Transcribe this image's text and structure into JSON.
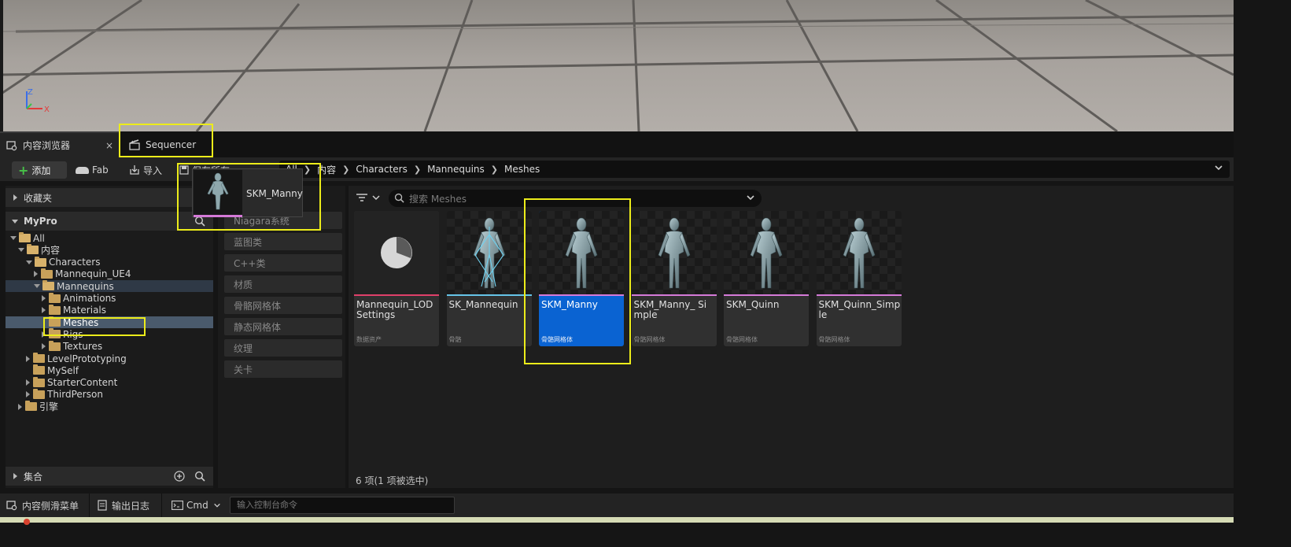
{
  "viewport": {
    "axis_z": "Z",
    "axis_x": "X"
  },
  "tabs": [
    {
      "label": "内容浏览器",
      "icon": "content-browser-icon",
      "close": "×"
    },
    {
      "label": "Sequencer",
      "icon": "clapperboard-icon"
    }
  ],
  "toolbar": {
    "add_label": "添加",
    "fab_label": "Fab",
    "import_label": "导入",
    "save_all_label": "保存所有"
  },
  "breadcrumb": [
    "All",
    "内容",
    "Characters",
    "Mannequins",
    "Meshes"
  ],
  "left_panel": {
    "favorites_label": "收藏夹",
    "project_label": "MyPro",
    "collections_label": "集合",
    "tree": [
      {
        "label": "All",
        "depth": 0,
        "expanded": true,
        "has_children": true
      },
      {
        "label": "内容",
        "depth": 1,
        "expanded": true,
        "has_children": true
      },
      {
        "label": "Characters",
        "depth": 2,
        "expanded": true,
        "has_children": true
      },
      {
        "label": "Mannequin_UE4",
        "depth": 3,
        "expanded": false,
        "has_children": true
      },
      {
        "label": "Mannequins",
        "depth": 3,
        "expanded": true,
        "has_children": true,
        "highlight": true
      },
      {
        "label": "Animations",
        "depth": 4,
        "expanded": false,
        "has_children": true
      },
      {
        "label": "Materials",
        "depth": 4,
        "expanded": false,
        "has_children": true
      },
      {
        "label": "Meshes",
        "depth": 4,
        "expanded": false,
        "has_children": false,
        "selected": true
      },
      {
        "label": "Rigs",
        "depth": 4,
        "expanded": false,
        "has_children": true
      },
      {
        "label": "Textures",
        "depth": 4,
        "expanded": false,
        "has_children": true
      },
      {
        "label": "LevelPrototyping",
        "depth": 2,
        "expanded": false,
        "has_children": true
      },
      {
        "label": "MySelf",
        "depth": 2,
        "expanded": false,
        "has_children": false
      },
      {
        "label": "StarterContent",
        "depth": 2,
        "expanded": false,
        "has_children": true
      },
      {
        "label": "ThirdPerson",
        "depth": 2,
        "expanded": false,
        "has_children": true
      },
      {
        "label": "引擎",
        "depth": 1,
        "expanded": false,
        "has_children": true
      }
    ]
  },
  "filters": [
    "Niagara系统",
    "蓝图类",
    "C++类",
    "材质",
    "骨骼网格体",
    "静态网格体",
    "纹理",
    "关卡"
  ],
  "search": {
    "placeholder": "搜索 Meshes"
  },
  "assets": [
    {
      "name": "Mannequin_LOD Settings",
      "type": "数据资产",
      "stripe": "#e0406a",
      "kind": "data",
      "selected": false
    },
    {
      "name": "SK_Mannequin",
      "type": "骨骼",
      "stripe": "#66c4e8",
      "kind": "skeleton",
      "selected": false
    },
    {
      "name": "SKM_Manny",
      "type": "骨骼网格体",
      "stripe": "#d57ad8",
      "kind": "mesh",
      "selected": true
    },
    {
      "name": "SKM_Manny_ Simple",
      "type": "骨骼网格体",
      "stripe": "#d57ad8",
      "kind": "mesh",
      "selected": false
    },
    {
      "name": "SKM_Quinn",
      "type": "骨骼网格体",
      "stripe": "#d57ad8",
      "kind": "mesh",
      "selected": false
    },
    {
      "name": "SKM_Quinn_Simple",
      "type": "骨骼网格体",
      "stripe": "#d57ad8",
      "kind": "mesh",
      "selected": false
    }
  ],
  "status": {
    "count_text": "6 项(1 项被选中)"
  },
  "drag_tooltip": {
    "name": "SKM_Manny"
  },
  "bottom_bar": {
    "drawer_label": "内容侧滑菜单",
    "log_label": "输出日志",
    "cmd_label": "Cmd",
    "console_placeholder": "输入控制台命令"
  },
  "colors": {
    "accent": "#0a63d2",
    "highlight_box": "#ecec1a",
    "add_green": "#47c148",
    "folder": "#c8a15a"
  }
}
